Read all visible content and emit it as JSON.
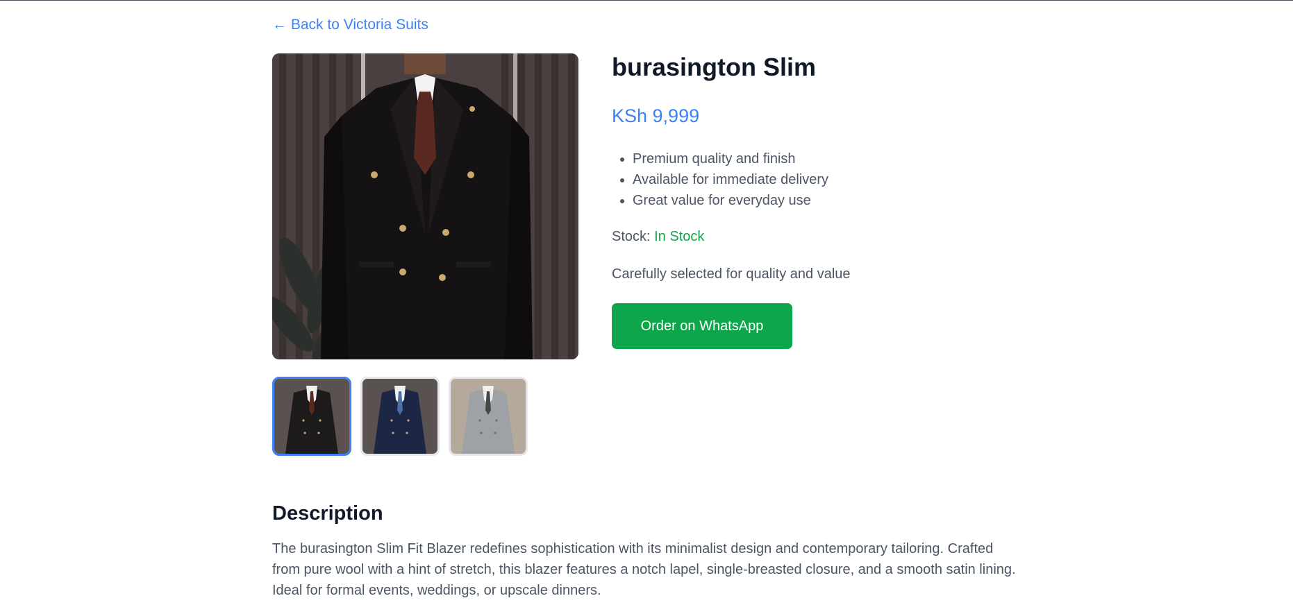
{
  "nav": {
    "back_label": "← Back to Victoria Suits"
  },
  "product": {
    "title": "burasington Slim",
    "price": "KSh 9,999",
    "features": [
      "Premium quality and finish",
      "Available for immediate delivery",
      "Great value for everyday use"
    ],
    "stock_label": "Stock:",
    "stock_value": "In Stock",
    "tagline": "Carefully selected for quality and value",
    "order_button": "Order on WhatsApp"
  },
  "gallery": {
    "main_image": "black-double-breasted-blazer-photo",
    "thumbnails": [
      {
        "icon": "black-blazer-thumbnail",
        "color": "#1c1a1b",
        "active": true
      },
      {
        "icon": "navy-blazer-thumbnail",
        "color": "#1b2745",
        "active": false
      },
      {
        "icon": "grey-blazer-thumbnail",
        "color": "#9ea1a6",
        "active": false
      }
    ]
  },
  "description": {
    "heading": "Description",
    "text": "The burasington Slim Fit Blazer redefines sophistication with its minimalist design and contemporary tailoring. Crafted from pure wool with a hint of stretch, this blazer features a notch lapel, single-breasted closure, and a smooth satin lining. Ideal for formal events, weddings, or upscale dinners."
  },
  "colors": {
    "accent": "#3b82f6",
    "in_stock": "#16a34a",
    "whatsapp": "#0ea64a",
    "text_muted": "#4b5563",
    "heading": "#111827"
  }
}
